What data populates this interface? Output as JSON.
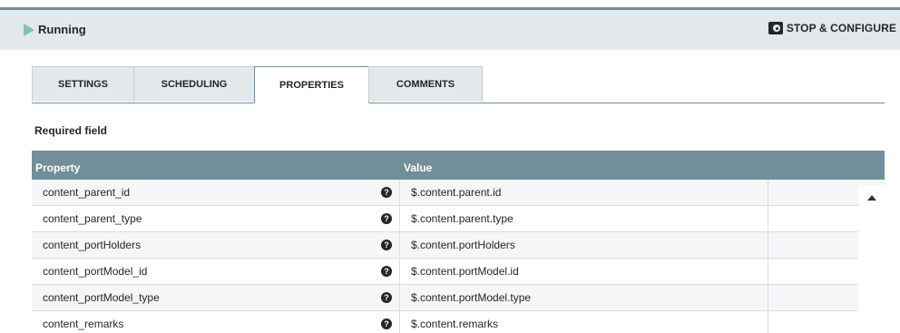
{
  "status": {
    "label": "Running"
  },
  "actions": {
    "stop_configure": "STOP & CONFIGURE"
  },
  "tabs": [
    {
      "label": "SETTINGS"
    },
    {
      "label": "SCHEDULING"
    },
    {
      "label": "PROPERTIES",
      "active": true
    },
    {
      "label": "COMMENTS"
    }
  ],
  "required_label": "Required field",
  "table": {
    "columns": {
      "property": "Property",
      "value": "Value"
    },
    "rows": [
      {
        "property": "content_parent_id",
        "value": "$.content.parent.id"
      },
      {
        "property": "content_parent_type",
        "value": "$.content.parent.type"
      },
      {
        "property": "content_portHolders",
        "value": "$.content.portHolders"
      },
      {
        "property": "content_portModel_id",
        "value": "$.content.portModel.id"
      },
      {
        "property": "content_portModel_type",
        "value": "$.content.portModel.type"
      },
      {
        "property": "content_remarks",
        "value": "$.content.remarks"
      }
    ]
  },
  "colors": {
    "header": "#728e9b",
    "status_bg": "#e3e8eb",
    "running": "#7dc7a0"
  },
  "icons": {
    "status": "play-icon",
    "stop": "stop-configure-icon",
    "help": "help-icon",
    "scroll": "scroll-up-icon"
  }
}
